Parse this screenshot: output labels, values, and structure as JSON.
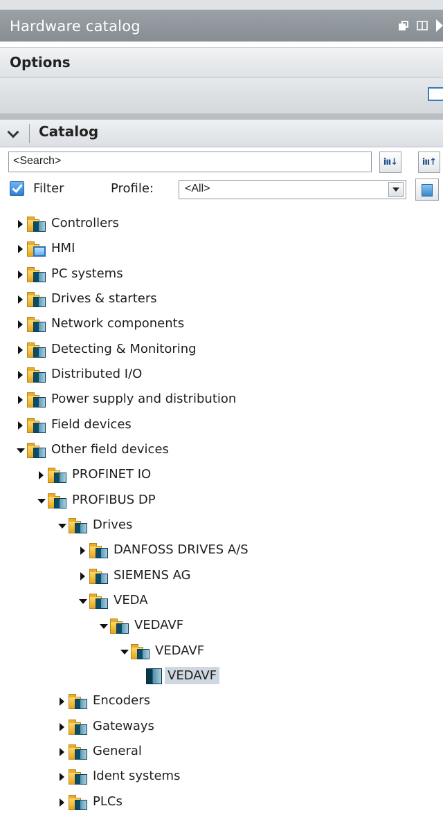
{
  "window": {
    "title": "Hardware catalog"
  },
  "options": {
    "label": "Options"
  },
  "catalog": {
    "label": "Catalog",
    "search_placeholder": "<Search>",
    "filter_label": "Filter",
    "filter_checked": true,
    "profile_label": "Profile:",
    "profile_value": "<All>"
  },
  "tree": [
    {
      "label": "Controllers",
      "depth": 0,
      "state": "collapsed",
      "icon": "folder-icon"
    },
    {
      "label": "HMI",
      "depth": 0,
      "state": "collapsed",
      "icon": "hmi-folder-icon"
    },
    {
      "label": "PC systems",
      "depth": 0,
      "state": "collapsed",
      "icon": "folder-icon"
    },
    {
      "label": "Drives & starters",
      "depth": 0,
      "state": "collapsed",
      "icon": "folder-icon"
    },
    {
      "label": "Network components",
      "depth": 0,
      "state": "collapsed",
      "icon": "folder-icon"
    },
    {
      "label": "Detecting & Monitoring",
      "depth": 0,
      "state": "collapsed",
      "icon": "folder-icon"
    },
    {
      "label": "Distributed I/O",
      "depth": 0,
      "state": "collapsed",
      "icon": "folder-icon"
    },
    {
      "label": "Power supply and distribution",
      "depth": 0,
      "state": "collapsed",
      "icon": "folder-icon"
    },
    {
      "label": "Field devices",
      "depth": 0,
      "state": "collapsed",
      "icon": "folder-icon"
    },
    {
      "label": "Other field devices",
      "depth": 0,
      "state": "expanded",
      "icon": "folder-icon"
    },
    {
      "label": "PROFINET IO",
      "depth": 1,
      "state": "collapsed",
      "icon": "folder-icon"
    },
    {
      "label": "PROFIBUS DP",
      "depth": 1,
      "state": "expanded",
      "icon": "folder-icon"
    },
    {
      "label": "Drives",
      "depth": 2,
      "state": "expanded",
      "icon": "folder-icon"
    },
    {
      "label": "DANFOSS DRIVES A/S",
      "depth": 3,
      "state": "collapsed",
      "icon": "folder-icon"
    },
    {
      "label": "SIEMENS AG",
      "depth": 3,
      "state": "collapsed",
      "icon": "folder-icon"
    },
    {
      "label": "VEDA",
      "depth": 3,
      "state": "expanded",
      "icon": "folder-icon"
    },
    {
      "label": "VEDAVF",
      "depth": 4,
      "state": "expanded",
      "icon": "folder-icon"
    },
    {
      "label": "VEDAVF",
      "depth": 5,
      "state": "expanded",
      "icon": "folder-icon"
    },
    {
      "label": "VEDAVF",
      "depth": 6,
      "state": "leaf",
      "icon": "device-icon",
      "selected": true
    },
    {
      "label": "Encoders",
      "depth": 2,
      "state": "collapsed",
      "icon": "folder-icon"
    },
    {
      "label": "Gateways",
      "depth": 2,
      "state": "collapsed",
      "icon": "folder-icon"
    },
    {
      "label": "General",
      "depth": 2,
      "state": "collapsed",
      "icon": "folder-icon"
    },
    {
      "label": "Ident systems",
      "depth": 2,
      "state": "collapsed",
      "icon": "folder-icon"
    },
    {
      "label": "PLCs",
      "depth": 2,
      "state": "collapsed",
      "icon": "folder-icon"
    }
  ]
}
